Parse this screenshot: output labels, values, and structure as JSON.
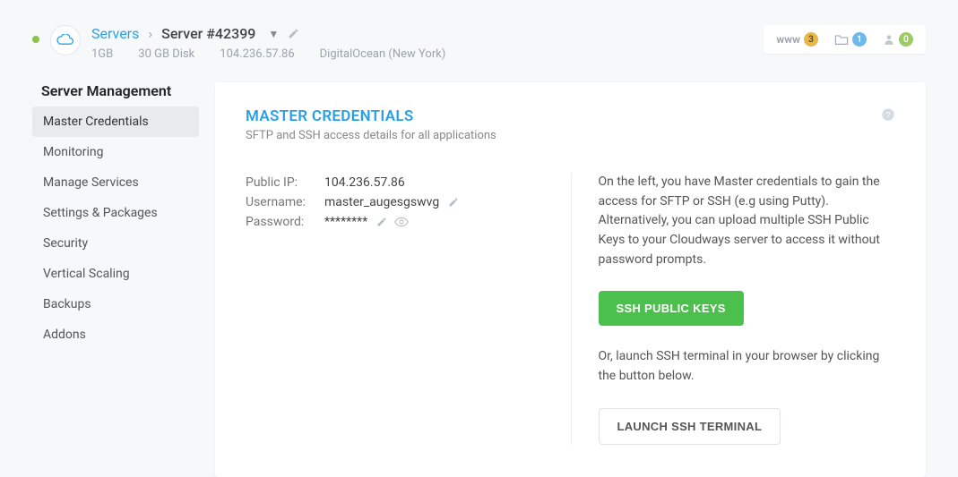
{
  "header": {
    "breadcrumb": {
      "link": "Servers",
      "current": "Server #42399"
    },
    "stats": {
      "ram": "1GB",
      "disk": "30 GB Disk",
      "ip": "104.236.57.86",
      "provider": "DigitalOcean (New York)"
    },
    "badges": {
      "www_label": "www",
      "www_count": "3",
      "apps_count": "1",
      "users_count": "0"
    }
  },
  "sidebar": {
    "title": "Server Management",
    "items": [
      {
        "label": "Master Credentials"
      },
      {
        "label": "Monitoring"
      },
      {
        "label": "Manage Services"
      },
      {
        "label": "Settings & Packages"
      },
      {
        "label": "Security"
      },
      {
        "label": "Vertical Scaling"
      },
      {
        "label": "Backups"
      },
      {
        "label": "Addons"
      }
    ]
  },
  "panel": {
    "title": "MASTER CREDENTIALS",
    "subtitle": "SFTP and SSH access details for all applications",
    "creds": {
      "ip_label": "Public IP:",
      "ip_value": "104.236.57.86",
      "user_label": "Username:",
      "user_value": "master_augesgswvg",
      "pass_label": "Password:",
      "pass_value": "********"
    },
    "right": {
      "para1": "On the left, you have Master credentials to gain the access for SFTP or SSH (e.g using Putty). Alternatively, you can upload multiple SSH Public Keys to your Cloudways server to access it without password prompts.",
      "ssh_btn": "SSH PUBLIC KEYS",
      "para2": "Or, launch SSH terminal in your browser by clicking the button below.",
      "launch_btn": "LAUNCH SSH TERMINAL"
    }
  }
}
